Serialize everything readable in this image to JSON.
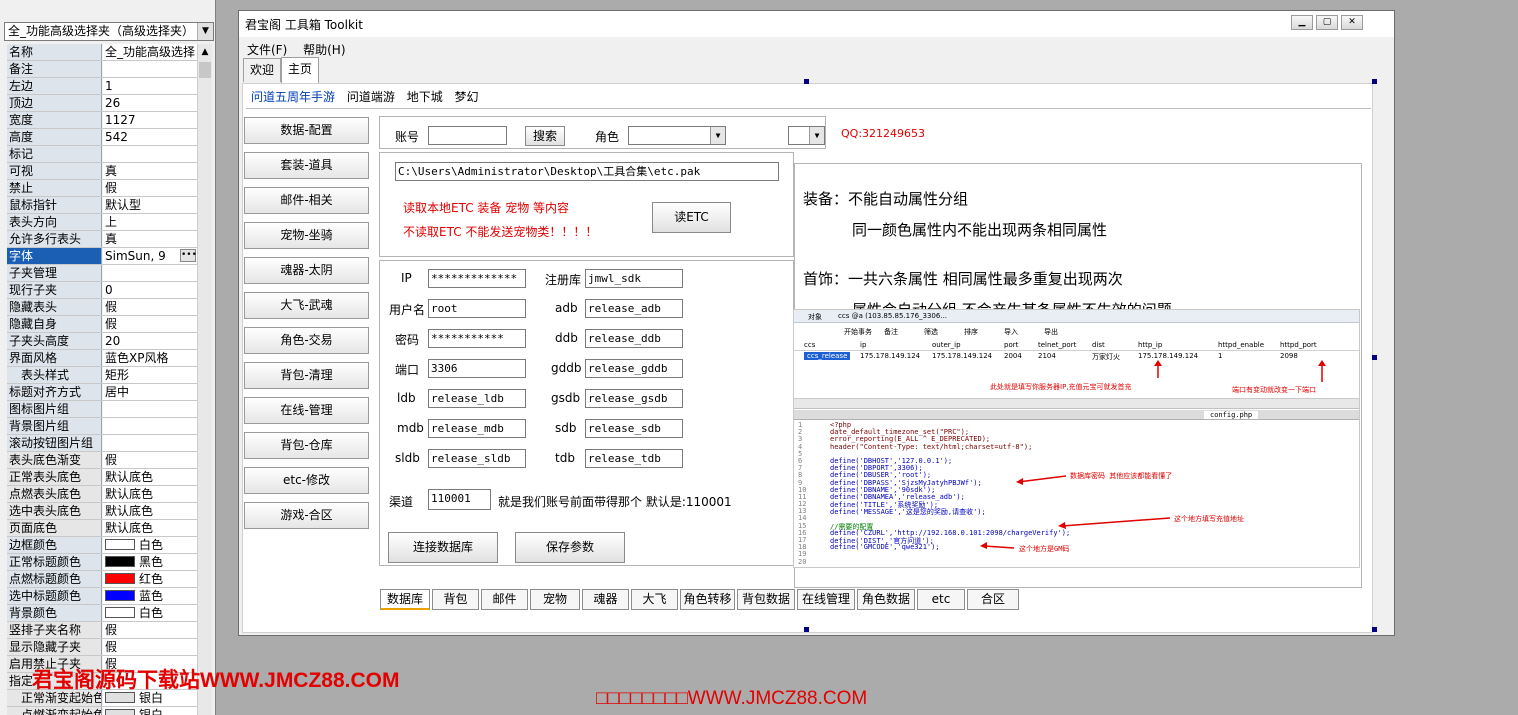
{
  "propPanel": {
    "object_combo": "全_功能高级选择夹（高级选择夹）",
    "rows": [
      {
        "name": "名称",
        "value": "全_功能高级选择"
      },
      {
        "name": "备注",
        "value": ""
      },
      {
        "name": "左边",
        "value": "1"
      },
      {
        "name": "顶边",
        "value": "26"
      },
      {
        "name": "宽度",
        "value": "1127"
      },
      {
        "name": "高度",
        "value": "542"
      },
      {
        "name": "标记",
        "value": ""
      },
      {
        "name": "可视",
        "value": "真"
      },
      {
        "name": "禁止",
        "value": "假"
      },
      {
        "name": "鼠标指针",
        "value": "默认型"
      },
      {
        "name": "表头方向",
        "value": "上"
      },
      {
        "name": "允许多行表头",
        "value": "真"
      },
      {
        "name": "字体",
        "value": "SimSun, 9"
      },
      {
        "name": "子夹管理",
        "value": ""
      },
      {
        "name": "现行子夹",
        "value": "0"
      },
      {
        "name": "隐藏表头",
        "value": "假"
      },
      {
        "name": "隐藏自身",
        "value": "假"
      },
      {
        "name": "子夹头高度",
        "value": "20"
      },
      {
        "name": "界面风格",
        "value": "蓝色XP风格"
      },
      {
        "name": "表头样式",
        "value": "矩形"
      },
      {
        "name": "标题对齐方式",
        "value": "居中"
      },
      {
        "name": "图标图片组",
        "value": ""
      },
      {
        "name": "背景图片组",
        "value": ""
      },
      {
        "name": "滚动按钮图片组",
        "value": ""
      },
      {
        "name": "表头底色渐变",
        "value": "假"
      },
      {
        "name": "正常表头底色",
        "value": "默认底色"
      },
      {
        "name": "点燃表头底色",
        "value": "默认底色"
      },
      {
        "name": "选中表头底色",
        "value": "默认底色"
      },
      {
        "name": "页面底色",
        "value": "默认底色"
      },
      {
        "name": "边框颜色",
        "value": "白色"
      },
      {
        "name": "正常标题颜色",
        "value": "黑色"
      },
      {
        "name": "点燃标题颜色",
        "value": "红色"
      },
      {
        "name": "选中标题颜色",
        "value": "蓝色"
      },
      {
        "name": "背景颜色",
        "value": "白色"
      },
      {
        "name": "竖排子夹名称",
        "value": "假"
      },
      {
        "name": "显示隐藏子夹",
        "value": "假"
      },
      {
        "name": "启用禁止子夹",
        "value": "假"
      },
      {
        "name": "指定",
        "value": ""
      },
      {
        "name": "正常渐变起始色",
        "value": "银白"
      },
      {
        "name": "点燃渐变起始色",
        "value": "银白"
      }
    ],
    "swatches": {
      "white": "#ffffff",
      "black": "#000000",
      "red": "#ff0000",
      "blue": "#0000ff",
      "silver": "#e0e0e0"
    }
  },
  "window": {
    "title": "君宝阁 工具箱 Toolkit",
    "menu": [
      "文件(F)",
      "帮助(H)"
    ],
    "page_tabs": [
      "欢迎",
      "主页"
    ],
    "game_tabs": [
      "问道五周年手游",
      "问道端游",
      "地下城",
      "梦幻"
    ],
    "side_buttons": [
      "数据-配置",
      "套装-道具",
      "邮件-相关",
      "宠物-坐骑",
      "魂器-太阴",
      "大飞-武魂",
      "角色-交易",
      "背包-清理",
      "在线-管理",
      "背包-仓库",
      "etc-修改",
      "游戏-合区"
    ],
    "search": {
      "account_label": "账号",
      "account_value": "",
      "search_button": "搜索",
      "role_label": "角色",
      "qq": "QQ:321249653"
    },
    "etc": {
      "path": "C:\\Users\\Administrator\\Desktop\\工具合集\\etc.pak",
      "hint1": "读取本地ETC 装备 宠物 等内容",
      "hint2": "不读取ETC 不能发送宠物类！！！！",
      "read_button": "读ETC"
    },
    "db": {
      "ip_label": "IP",
      "ip": "*************",
      "user_label": "用户名",
      "user": "root",
      "pwd_label": "密码",
      "pwd": "***********",
      "port_label": "端口",
      "port": "3306",
      "ldb_label": "ldb",
      "ldb": "release_ldb",
      "mdb_label": "mdb",
      "mdb": "release_mdb",
      "sldb_label": "sldb",
      "sldb": "release_sldb",
      "reg_label": "注册库",
      "reg": "jmwl_sdk",
      "adb_label": "adb",
      "adb": "release_adb",
      "ddb_label": "ddb",
      "ddb": "release_ddb",
      "gddb_label": "gddb",
      "gddb": "release_gddb",
      "gsdb_label": "gsdb",
      "gsdb": "release_gsdb",
      "sdb_label": "sdb",
      "sdb": "release_sdb",
      "tdb_label": "tdb",
      "tdb": "release_tdb",
      "channel_label": "渠道",
      "channel": "110001",
      "channel_note": "就是我们账号前面带得那个 默认是:110001",
      "connect_button": "连接数据库",
      "save_button": "保存参数"
    },
    "notes": {
      "line1": "装备：不能自动属性分组",
      "line2": "同一颜色属性内不能出现两条相同属性",
      "line3": "首饰：一共六条属性 相同属性最多重复出现两次",
      "line4": "属性会自动分组 不会产生某条属性不生效的问题"
    },
    "bottom_tabs": [
      "数据库",
      "背包",
      "邮件",
      "宠物",
      "魂器",
      "大飞",
      "角色转移",
      "背包数据",
      "在线管理",
      "角色数据",
      "etc",
      "合区"
    ]
  },
  "shotA": {
    "tab": "对象",
    "title": "ccs @a (103.85.85.176_3306...",
    "toolbar": [
      "开始事务",
      "备注",
      "筛选",
      "排序",
      "导入",
      "导出"
    ],
    "headers": [
      "ccs",
      "ip",
      "outer_ip",
      "port",
      "telnet_port",
      "dist",
      "http_ip",
      "httpd_enable",
      "httpd_port"
    ],
    "row": [
      "ccs_release",
      "175.178.149.124",
      "175.178.149.124",
      "2004",
      "2104",
      "万家灯火",
      "175.178.149.124",
      "1",
      "2098"
    ],
    "note1": "此处就是填写你服务器IP,充值元宝可就发首充",
    "note2": "端口有变动就改变一下端口"
  },
  "shotB": {
    "file_tab": "config.php",
    "lines": [
      "<?php",
      "date_default_timezone_set(\"PRC\");",
      "error_reporting(E_ALL ^ E_DEPRECATED);",
      "header(\"Content-Type: text/html;charset=utf-8\");",
      "",
      "define('DBHOST','127.0.0.1');",
      "define('DBPORT',3306);",
      "define('DBUSER','root');",
      "define('DBPASS','SjzsMyJatyhPBJWf');",
      "define('DBNAME','90sdk');",
      "define('DBNAMEA','release_adb');",
      "define('TITLE','系统奖励');",
      "define('MESSAGE','这是您的奖励,请查收');",
      "",
      "//需要的配置",
      "define('CZURL','http://192.168.0.101:2098/chargeVerify');",
      "define('DIST','官方问道');",
      "define('GMCODE','qwe321');",
      "",
      ""
    ],
    "note1": "数据库密码 其他应该都能看懂了",
    "note2": "这个地方填写充值地址",
    "note3": "这个地方是GM码"
  },
  "watermark1": "君宝阁源码下载站WWW.JMCZ88.COM",
  "watermark2": "□□□□□□□□WWW.JMCZ88.COM"
}
